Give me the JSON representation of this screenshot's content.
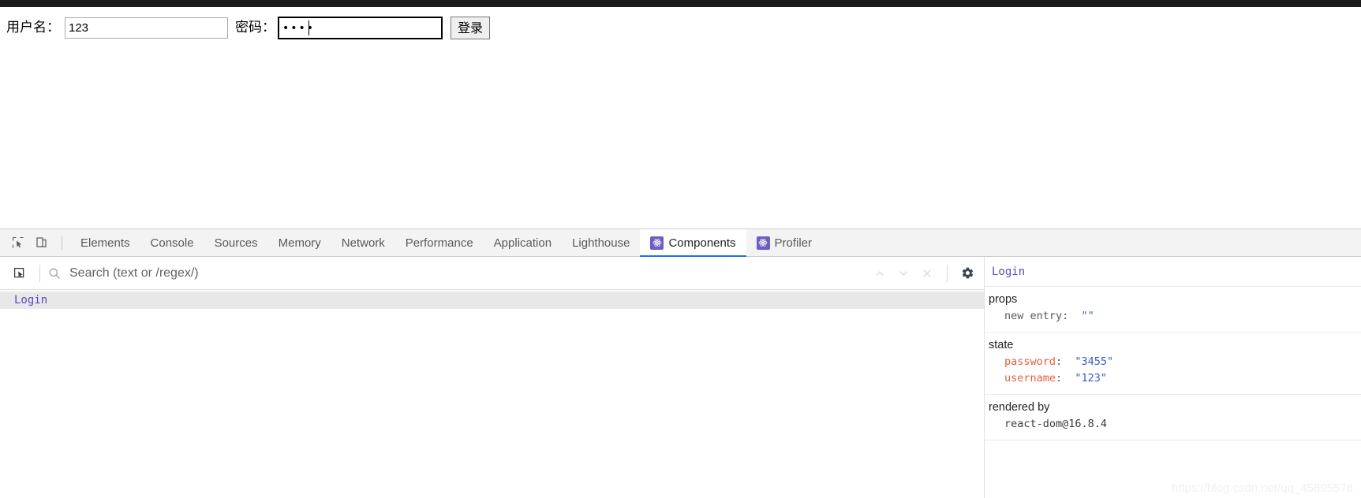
{
  "page": {
    "form": {
      "username_label": "用户名：",
      "username_value": "123",
      "password_label": "密码：",
      "password_masked": "••••",
      "submit_label": "登录"
    }
  },
  "devtools": {
    "tabs": [
      {
        "label": "Elements",
        "active": false,
        "icon": null
      },
      {
        "label": "Console",
        "active": false,
        "icon": null
      },
      {
        "label": "Sources",
        "active": false,
        "icon": null
      },
      {
        "label": "Memory",
        "active": false,
        "icon": null
      },
      {
        "label": "Network",
        "active": false,
        "icon": null
      },
      {
        "label": "Performance",
        "active": false,
        "icon": null
      },
      {
        "label": "Application",
        "active": false,
        "icon": null
      },
      {
        "label": "Lighthouse",
        "active": false,
        "icon": null
      },
      {
        "label": "Components",
        "active": true,
        "icon": "react-atom-icon"
      },
      {
        "label": "Profiler",
        "active": false,
        "icon": "react-atom-icon"
      }
    ],
    "toolbar_icons": {
      "inspect": "inspect-element-icon",
      "device": "device-toolbar-icon"
    },
    "search": {
      "placeholder": "Search (text or /regex/)",
      "value": "",
      "icons": {
        "select": "select-component-icon",
        "magnifier": "search-icon",
        "prev": "chevron-up-icon",
        "next": "chevron-down-icon",
        "clear": "close-icon",
        "settings": "gear-icon"
      }
    },
    "tree": {
      "items": [
        {
          "label": "Login",
          "selected": true
        }
      ]
    },
    "inspector": {
      "component_name": "Login",
      "sections": [
        {
          "title": "props",
          "kind": "kv",
          "rows": [
            {
              "key": "new entry",
              "key_style": "plain",
              "value": "\"\""
            }
          ]
        },
        {
          "title": "state",
          "kind": "kv",
          "rows": [
            {
              "key": "password",
              "key_style": "name",
              "value": "\"3455\""
            },
            {
              "key": "username",
              "key_style": "name",
              "value": "\"123\""
            }
          ]
        },
        {
          "title": "rendered by",
          "kind": "plain",
          "lines": [
            "react-dom@16.8.4"
          ]
        }
      ]
    }
  },
  "watermark": "https://blog.csdn.net/qq_45895576",
  "colors": {
    "accent": "#1a73e8",
    "react_badge": "#6f5ec0",
    "component_purple": "#5c49b5",
    "key_orange": "#e8603c",
    "value_blue": "#3a5bc7",
    "tabbar_bg": "#f3f3f3"
  }
}
